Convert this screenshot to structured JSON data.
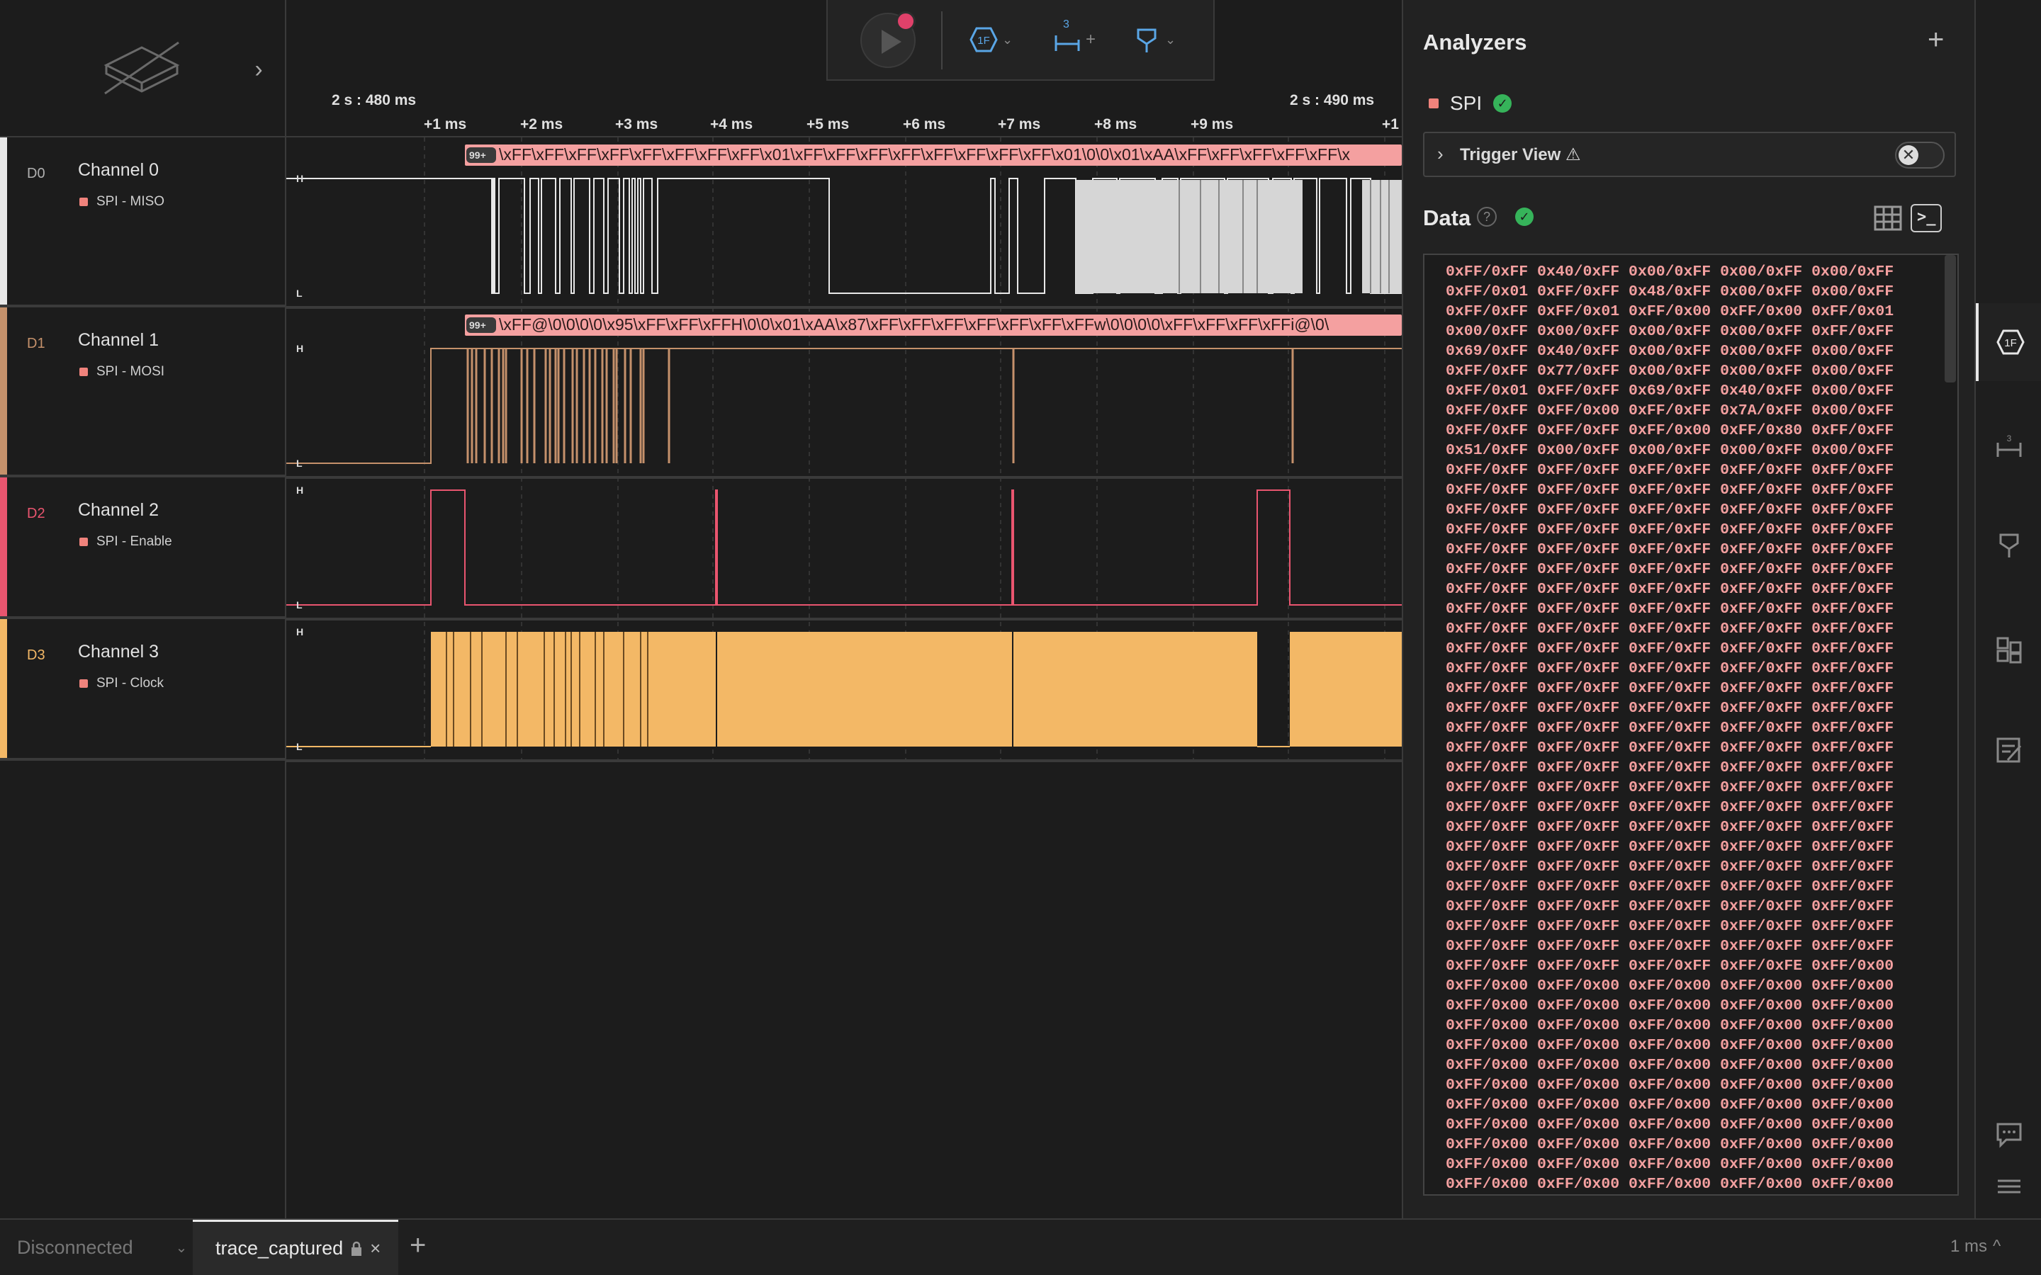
{
  "toolbar": {
    "play_icon": "play-icon",
    "record_icon": "record-dot-icon",
    "trigger_icon": "hexagon-1f-icon",
    "measure_label": "3",
    "measure_plus": "+",
    "marker_icon": "marker-icon",
    "colors": {
      "accent": "#5aa6e6",
      "record": "#e0416a"
    }
  },
  "ruler": {
    "start_abs": "2 s : 480 ms",
    "end_abs": "2 s : 490 ms",
    "ticks": [
      "+1 ms",
      "+2 ms",
      "+3 ms",
      "+4 ms",
      "+5 ms",
      "+6 ms",
      "+7 ms",
      "+8 ms",
      "+9 ms",
      "+1"
    ]
  },
  "channels": [
    {
      "id": "D0",
      "name": "Channel 0",
      "analyzer": "SPI - MISO",
      "color": "#e8e8e8"
    },
    {
      "id": "D1",
      "name": "Channel 1",
      "analyzer": "SPI - MOSI",
      "color": "#c5916b"
    },
    {
      "id": "D2",
      "name": "Channel 2",
      "analyzer": "SPI - Enable",
      "color": "#e9556f"
    },
    {
      "id": "D3",
      "name": "Channel 3",
      "analyzer": "SPI - Clock",
      "color": "#f3b866"
    }
  ],
  "level_labels": {
    "high": "H",
    "low": "L"
  },
  "annotations": {
    "badge": "99+",
    "miso": "\\xFF\\xFF\\xFF\\xFF\\xFF\\xFF\\xFF\\xFF\\x01\\xFF\\xFF\\xFF\\xFF\\xFF\\xFF\\xFF\\xFF\\x01\\0\\0\\x01\\xAA\\xFF\\xFF\\xFF\\xFF\\xFF\\x",
    "mosi": "\\xFF@\\0\\0\\0\\0\\x95\\xFF\\xFF\\xFFH\\0\\0\\x01\\xAA\\x87\\xFF\\xFF\\xFF\\xFF\\xFF\\xFF\\xFFw\\0\\0\\0\\0\\xFF\\xFF\\xFF\\xFFi@\\0\\"
  },
  "analyzers": {
    "title": "Analyzers",
    "add": "+",
    "items": [
      {
        "name": "SPI",
        "color": "#f0837c"
      }
    ],
    "trigger_view": {
      "label": "Trigger View ⚠",
      "enabled": false,
      "toggle_glyph": "✕"
    }
  },
  "data_panel": {
    "title": "Data",
    "help": "?",
    "lines": [
      "0xFF/0xFF 0x40/0xFF 0x00/0xFF 0x00/0xFF 0x00/0xFF",
      "0xFF/0x01 0xFF/0xFF 0x48/0xFF 0x00/0xFF 0x00/0xFF",
      "0xFF/0xFF 0xFF/0x01 0xFF/0x00 0xFF/0x00 0xFF/0x01",
      "0x00/0xFF 0x00/0xFF 0x00/0xFF 0x00/0xFF 0xFF/0xFF",
      "0x69/0xFF 0x40/0xFF 0x00/0xFF 0x00/0xFF 0x00/0xFF",
      "0xFF/0xFF 0x77/0xFF 0x00/0xFF 0x00/0xFF 0x00/0xFF",
      "0xFF/0x01 0xFF/0xFF 0x69/0xFF 0x40/0xFF 0x00/0xFF",
      "0xFF/0xFF 0xFF/0x00 0xFF/0xFF 0x7A/0xFF 0x00/0xFF",
      "0xFF/0xFF 0xFF/0xFF 0xFF/0x00 0xFF/0x80 0xFF/0xFF",
      "0x51/0xFF 0x00/0xFF 0x00/0xFF 0x00/0xFF 0x00/0xFF",
      "0xFF/0xFF 0xFF/0xFF 0xFF/0xFF 0xFF/0xFF 0xFF/0xFF",
      "0xFF/0xFF 0xFF/0xFF 0xFF/0xFF 0xFF/0xFF 0xFF/0xFF",
      "0xFF/0xFF 0xFF/0xFF 0xFF/0xFF 0xFF/0xFF 0xFF/0xFF",
      "0xFF/0xFF 0xFF/0xFF 0xFF/0xFF 0xFF/0xFF 0xFF/0xFF",
      "0xFF/0xFF 0xFF/0xFF 0xFF/0xFF 0xFF/0xFF 0xFF/0xFF",
      "0xFF/0xFF 0xFF/0xFF 0xFF/0xFF 0xFF/0xFF 0xFF/0xFF",
      "0xFF/0xFF 0xFF/0xFF 0xFF/0xFF 0xFF/0xFF 0xFF/0xFF",
      "0xFF/0xFF 0xFF/0xFF 0xFF/0xFF 0xFF/0xFF 0xFF/0xFF",
      "0xFF/0xFF 0xFF/0xFF 0xFF/0xFF 0xFF/0xFF 0xFF/0xFF",
      "0xFF/0xFF 0xFF/0xFF 0xFF/0xFF 0xFF/0xFF 0xFF/0xFF",
      "0xFF/0xFF 0xFF/0xFF 0xFF/0xFF 0xFF/0xFF 0xFF/0xFF",
      "0xFF/0xFF 0xFF/0xFF 0xFF/0xFF 0xFF/0xFF 0xFF/0xFF",
      "0xFF/0xFF 0xFF/0xFF 0xFF/0xFF 0xFF/0xFF 0xFF/0xFF",
      "0xFF/0xFF 0xFF/0xFF 0xFF/0xFF 0xFF/0xFF 0xFF/0xFF",
      "0xFF/0xFF 0xFF/0xFF 0xFF/0xFF 0xFF/0xFF 0xFF/0xFF",
      "0xFF/0xFF 0xFF/0xFF 0xFF/0xFF 0xFF/0xFF 0xFF/0xFF",
      "0xFF/0xFF 0xFF/0xFF 0xFF/0xFF 0xFF/0xFF 0xFF/0xFF",
      "0xFF/0xFF 0xFF/0xFF 0xFF/0xFF 0xFF/0xFF 0xFF/0xFF",
      "0xFF/0xFF 0xFF/0xFF 0xFF/0xFF 0xFF/0xFF 0xFF/0xFF",
      "0xFF/0xFF 0xFF/0xFF 0xFF/0xFF 0xFF/0xFF 0xFF/0xFF",
      "0xFF/0xFF 0xFF/0xFF 0xFF/0xFF 0xFF/0xFF 0xFF/0xFF",
      "0xFF/0xFF 0xFF/0xFF 0xFF/0xFF 0xFF/0xFF 0xFF/0xFF",
      "0xFF/0xFF 0xFF/0xFF 0xFF/0xFF 0xFF/0xFF 0xFF/0xFF",
      "0xFF/0xFF 0xFF/0xFF 0xFF/0xFF 0xFF/0xFF 0xFF/0xFF",
      "0xFF/0xFF 0xFF/0xFF 0xFF/0xFF 0xFF/0xFF 0xFF/0xFF",
      "0xFF/0xFF 0xFF/0xFF 0xFF/0xFF 0xFF/0xFE 0xFF/0x00",
      "0xFF/0x00 0xFF/0x00 0xFF/0x00 0xFF/0x00 0xFF/0x00",
      "0xFF/0x00 0xFF/0x00 0xFF/0x00 0xFF/0x00 0xFF/0x00",
      "0xFF/0x00 0xFF/0x00 0xFF/0x00 0xFF/0x00 0xFF/0x00",
      "0xFF/0x00 0xFF/0x00 0xFF/0x00 0xFF/0x00 0xFF/0x00",
      "0xFF/0x00 0xFF/0x00 0xFF/0x00 0xFF/0x00 0xFF/0x00",
      "0xFF/0x00 0xFF/0x00 0xFF/0x00 0xFF/0x00 0xFF/0x00",
      "0xFF/0x00 0xFF/0x00 0xFF/0x00 0xFF/0x00 0xFF/0x00",
      "0xFF/0x00 0xFF/0x00 0xFF/0x00 0xFF/0x00 0xFF/0x00",
      "0xFF/0x00 0xFF/0x00 0xFF/0x00 0xFF/0x00 0xFF/0x00",
      "0xFF/0x00 0xFF/0x00 0xFF/0x00 0xFF/0x00 0xFF/0x00",
      "0xFF/0x00 0xFF/0x00 0xFF/0x00 0xFF/0x00 0xFF/0x00"
    ]
  },
  "sidebar": {
    "items": [
      "analyzers-icon",
      "measurements-icon",
      "timing-marker-icon",
      "extensions-icon",
      "notes-icon",
      "feedback-icon",
      "menu-icon"
    ]
  },
  "bottom_bar": {
    "connection": "Disconnected",
    "tab": {
      "label": "trace_captured",
      "close": "×"
    },
    "new_tab": "+",
    "zoom": "1 ms",
    "zoom_caret": "^"
  }
}
